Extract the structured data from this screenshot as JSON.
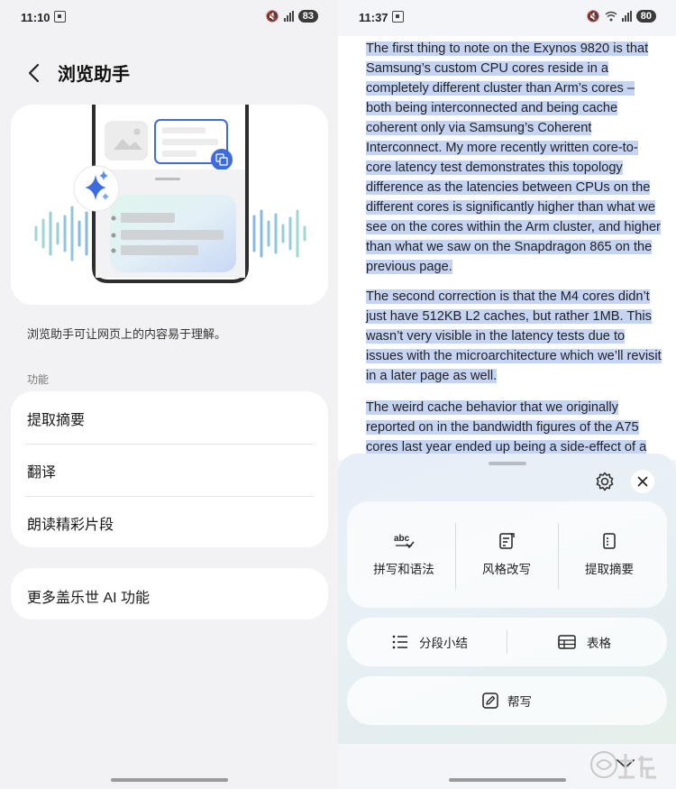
{
  "left": {
    "status": {
      "time": "11:10",
      "battery": "83"
    },
    "title": "浏览助手",
    "description": "浏览助手可让网页上的内容易于理解。",
    "section_label": "功能",
    "features": [
      "提取摘要",
      "翻译",
      "朗读精彩片段"
    ],
    "more_label": "更多盖乐世 AI 功能"
  },
  "right": {
    "status": {
      "time": "11:37",
      "battery": "80"
    },
    "paragraphs": [
      "The first thing to note on the Exynos 9820 is that Samsung’s custom CPU cores reside in a completely different cluster than Arm’s cores – both being interconnected and being cache coherent only via Samsung’s Coherent Interconnect. My more recently written core-to-core latency test demonstrates this topology difference as the latencies between CPUs on the different cores is significantly higher than what we see on the cores within the Arm cluster, and higher than what we saw on the Snapdragon 865 on the previous page.",
      "The second correction is that the M4 cores didn’t just have 512KB L2 caches, but rather 1MB. This wasn’t very visible in the latency tests due to issues with the microarchitecture which we’ll revisit in a later page as well.",
      "The weird cache behavior that we originally reported on in the bandwidth figures of the A75 cores last year ended up being a side-effect of a"
    ],
    "tools": [
      {
        "label": "拼写和语法",
        "icon": "spell-check-icon"
      },
      {
        "label": "风格改写",
        "icon": "rewrite-icon"
      },
      {
        "label": "提取摘要",
        "icon": "summary-icon"
      }
    ],
    "format_buttons": [
      {
        "label": "分段小结",
        "icon": "list-icon"
      },
      {
        "label": "表格",
        "icon": "table-icon"
      }
    ],
    "compose_label": "帮写",
    "spell_glyph": "abc"
  }
}
